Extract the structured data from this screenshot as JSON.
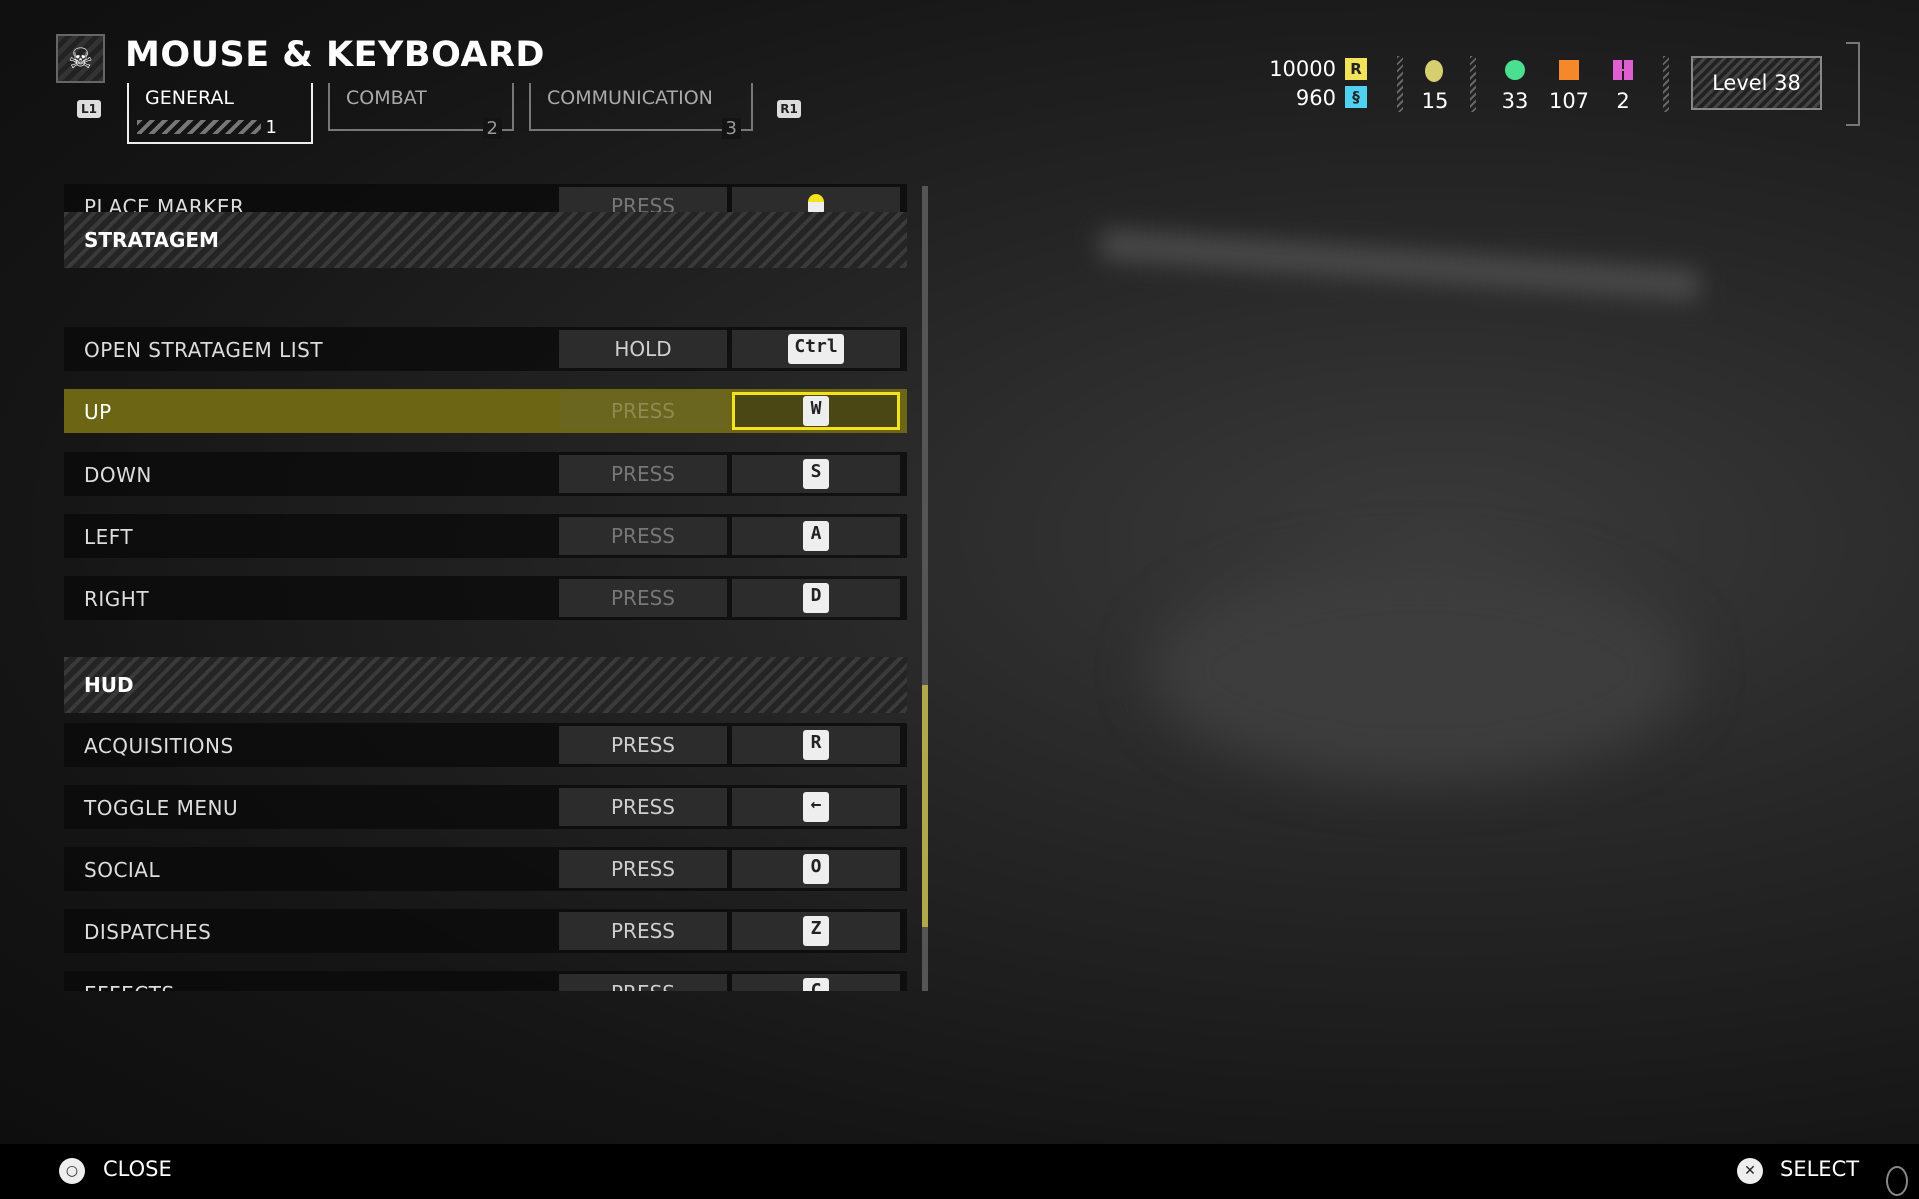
{
  "header": {
    "title": "MOUSE & KEYBOARD",
    "prev_hint": "L1",
    "next_hint": "R1",
    "tabs": [
      {
        "label": "GENERAL",
        "number": "1",
        "active": true
      },
      {
        "label": "COMBAT",
        "number": "2"
      },
      {
        "label": "COMMUNICATION",
        "number": "3"
      }
    ]
  },
  "resources": {
    "requisition": "10000",
    "requisition_icon": "R",
    "medals_super": "960",
    "medals": "15",
    "samples_common": "33",
    "samples_rare": "107",
    "samples_super": "2",
    "level": "Level 38",
    "colors": {
      "requisition": "#f2e45a",
      "super_credits": "#4fd2f0",
      "common": "#4be08f",
      "rare": "#f5892a",
      "super": "#e05fd0"
    }
  },
  "bindings": [
    {
      "type": "row",
      "label": "PLACE MARKER",
      "mode": "PRESS",
      "key": "mouse-middle-icon",
      "dim": true
    },
    {
      "type": "header",
      "label": "STRATAGEM"
    },
    {
      "type": "row",
      "label": "OPEN STRATAGEM LIST",
      "mode": "HOLD",
      "key": "Ctrl"
    },
    {
      "type": "row",
      "label": "UP",
      "mode": "PRESS",
      "key": "W",
      "dim": true,
      "selected": true
    },
    {
      "type": "row",
      "label": "DOWN",
      "mode": "PRESS",
      "key": "S",
      "dim": true
    },
    {
      "type": "row",
      "label": "LEFT",
      "mode": "PRESS",
      "key": "A",
      "dim": true
    },
    {
      "type": "row",
      "label": "RIGHT",
      "mode": "PRESS",
      "key": "D",
      "dim": true
    },
    {
      "type": "header",
      "label": "HUD"
    },
    {
      "type": "row",
      "label": "ACQUISITIONS",
      "mode": "PRESS",
      "key": "R"
    },
    {
      "type": "row",
      "label": "TOGGLE MENU",
      "mode": "PRESS",
      "key": "←"
    },
    {
      "type": "row",
      "label": "SOCIAL",
      "mode": "PRESS",
      "key": "O"
    },
    {
      "type": "row",
      "label": "DISPATCHES",
      "mode": "PRESS",
      "key": "Z"
    },
    {
      "type": "row",
      "label": "EFFECTS",
      "mode": "PRESS",
      "key": "C"
    }
  ],
  "scroll": {
    "position_fraction": 0.62,
    "visible_fraction": 0.3,
    "thumb_color": "#b0a84a"
  },
  "accent": "#f2e31c",
  "footer": {
    "close_label": "CLOSE",
    "close_icon": "circle-button-icon",
    "select_label": "SELECT",
    "select_icon": "cross-button-icon"
  }
}
